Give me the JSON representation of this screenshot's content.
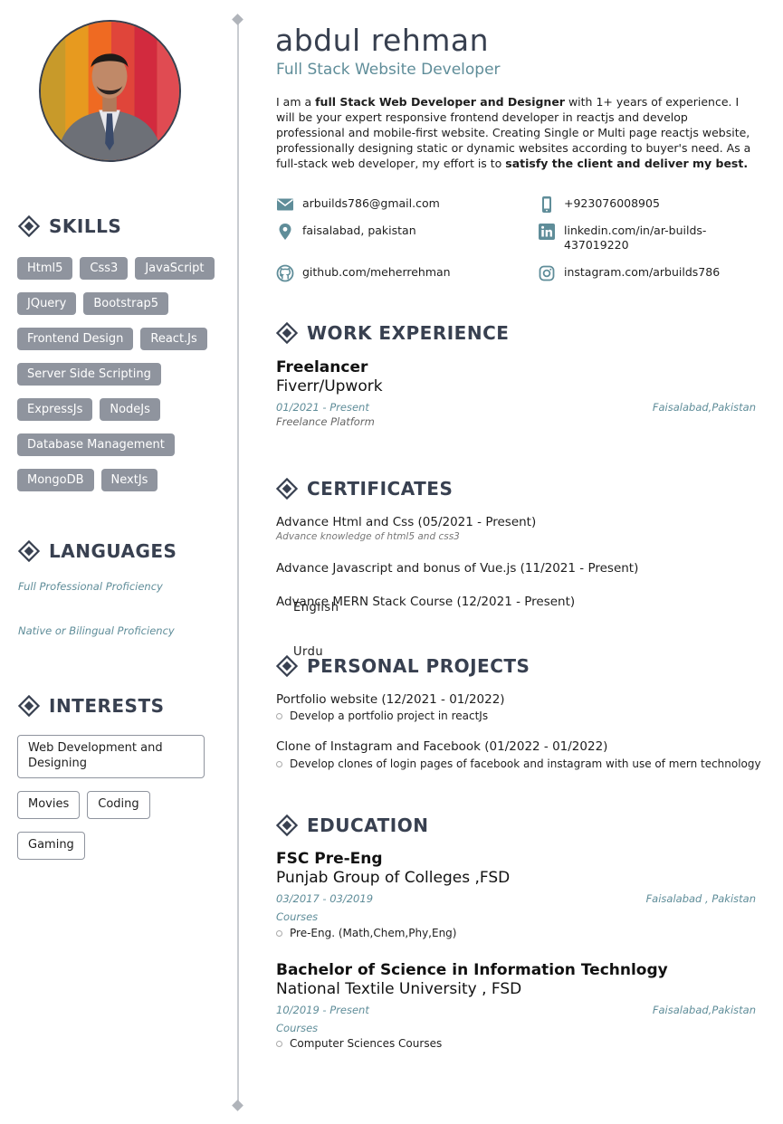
{
  "header": {
    "name": "abdul rehman",
    "role": "Full Stack Website Developer",
    "summary": {
      "p1": "I am a ",
      "b1": "full Stack Web Developer and Designer",
      "p2": " with 1+ years of experience. I will be your expert responsive frontend developer in reactjs and develop professional and mobile-first website. Creating Single or Multi page reactjs website, professionally designing static or dynamic websites according to buyer's need. As a full-stack web developer, my effort is to ",
      "b2": "satisfy the client and deliver my best."
    }
  },
  "contact": {
    "email": "arbuilds786@gmail.com",
    "phone": "+923076008905",
    "location": "faisalabad, pakistan",
    "linkedin": "linkedin.com/in/ar-builds-437019220",
    "github": "github.com/meherrehman",
    "instagram": "instagram.com/arbuilds786"
  },
  "skills": {
    "title": "SKILLS",
    "rows": [
      [
        "Html5",
        "Css3",
        "JavaScript"
      ],
      [
        "JQuery",
        "Bootstrap5"
      ],
      [
        "Frontend Design",
        "React.Js"
      ],
      [
        "Server Side Scripting"
      ],
      [
        "ExpressJs",
        "NodeJs"
      ],
      [
        "Database Management"
      ],
      [
        "MongoDB",
        "NextJs"
      ]
    ]
  },
  "languages": {
    "title": "LANGUAGES",
    "items": [
      {
        "name": "English",
        "level": "Full Professional Proficiency"
      },
      {
        "name": "Urdu",
        "level": "Native or Bilingual Proficiency"
      }
    ]
  },
  "interests": {
    "title": "INTERESTS",
    "items": [
      "Web Development and Designing",
      "Movies",
      "Coding",
      "Gaming"
    ]
  },
  "work": {
    "title": "WORK EXPERIENCE",
    "items": [
      {
        "title": "Freelancer",
        "org": "Fiverr/Upwork",
        "date": "01/2021 - Present",
        "location": "Faisalabad,Pakistan",
        "desc": "Freelance Platform"
      }
    ]
  },
  "certificates": {
    "title": "CERTIFICATES",
    "items": [
      {
        "name": "Advance Html and Css (05/2021 - Present)",
        "desc": "Advance knowledge of html5 and css3"
      },
      {
        "name": "Advance Javascript and bonus of Vue.js (11/2021 - Present)",
        "desc": ""
      },
      {
        "name": "Advance MERN Stack Course (12/2021 - Present)",
        "desc": ""
      }
    ]
  },
  "projects": {
    "title": "PERSONAL PROJECTS",
    "items": [
      {
        "name": "Portfolio website (12/2021 - 01/2022)",
        "bullet": "Develop a portfolio project in reactJs"
      },
      {
        "name": "Clone of Instagram and Facebook (01/2022 - 01/2022)",
        "bullet": "Develop clones of login pages of facebook and instagram with use of mern technology"
      }
    ]
  },
  "education": {
    "title": "EDUCATION",
    "items": [
      {
        "degree": "FSC Pre-Eng",
        "school": "Punjab Group of Colleges ,FSD",
        "date": "03/2017 - 03/2019",
        "location": "Faisalabad , Pakistan",
        "courses_label": "Courses",
        "course": "Pre-Eng. (Math,Chem,Phy,Eng)"
      },
      {
        "degree": "Bachelor of Science in Information Technlogy",
        "school": "National Textile University , FSD",
        "date": "10/2019 - Present",
        "location": "Faisalabad,Pakistan",
        "courses_label": "Courses",
        "course": "Computer Sciences Courses"
      }
    ]
  },
  "colors": {
    "heading": "#384050",
    "accent": "#5f8d99",
    "chip": "#8f949e"
  },
  "icons": [
    "section-diamond-icon",
    "email-icon",
    "phone-icon",
    "location-pin-icon",
    "linkedin-icon",
    "github-icon",
    "instagram-icon"
  ]
}
